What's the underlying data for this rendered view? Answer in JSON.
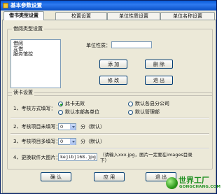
{
  "window": {
    "title": "基本参数设置"
  },
  "tabs": [
    {
      "label": "借书类型设置"
    },
    {
      "label": "校置设置"
    },
    {
      "label": "单位性质设置"
    },
    {
      "label": "单位名称设置"
    }
  ],
  "type_group": {
    "title": "借阅类型设置",
    "list_items": [
      "借阅",
      "互借",
      "服务馆控"
    ],
    "unit_label": "单位性质：",
    "unit_value": "",
    "add": "添 加",
    "delete": "删 除",
    "modify": "修 改",
    "exit": "退 出"
  },
  "reader_group": {
    "title": "读卡设置",
    "row1": {
      "label": "1、考核方式填写：",
      "options": [
        "此卡无效",
        "默认各县分公司",
        "默认本部各单位",
        "默认管理部"
      ],
      "selected_index": 0
    },
    "row2": {
      "label": "2、考核项目未填写：",
      "value": "0",
      "suffix": "分（默认）"
    },
    "row3": {
      "label": "3、考核项目多填写：",
      "value": "0",
      "suffix": "分（默认）"
    },
    "row4": {
      "label": "4、更换软件大图片：",
      "value": "kejibj168.jpg",
      "note": "（请输入xxx.jpg，图片一定要在images目录下）"
    }
  },
  "footer": {
    "ok": "确 认",
    "apply": "应 用",
    "exit": "退 出"
  },
  "watermark": {
    "name": "世界工厂",
    "url": "GONGCHANG.COM"
  }
}
